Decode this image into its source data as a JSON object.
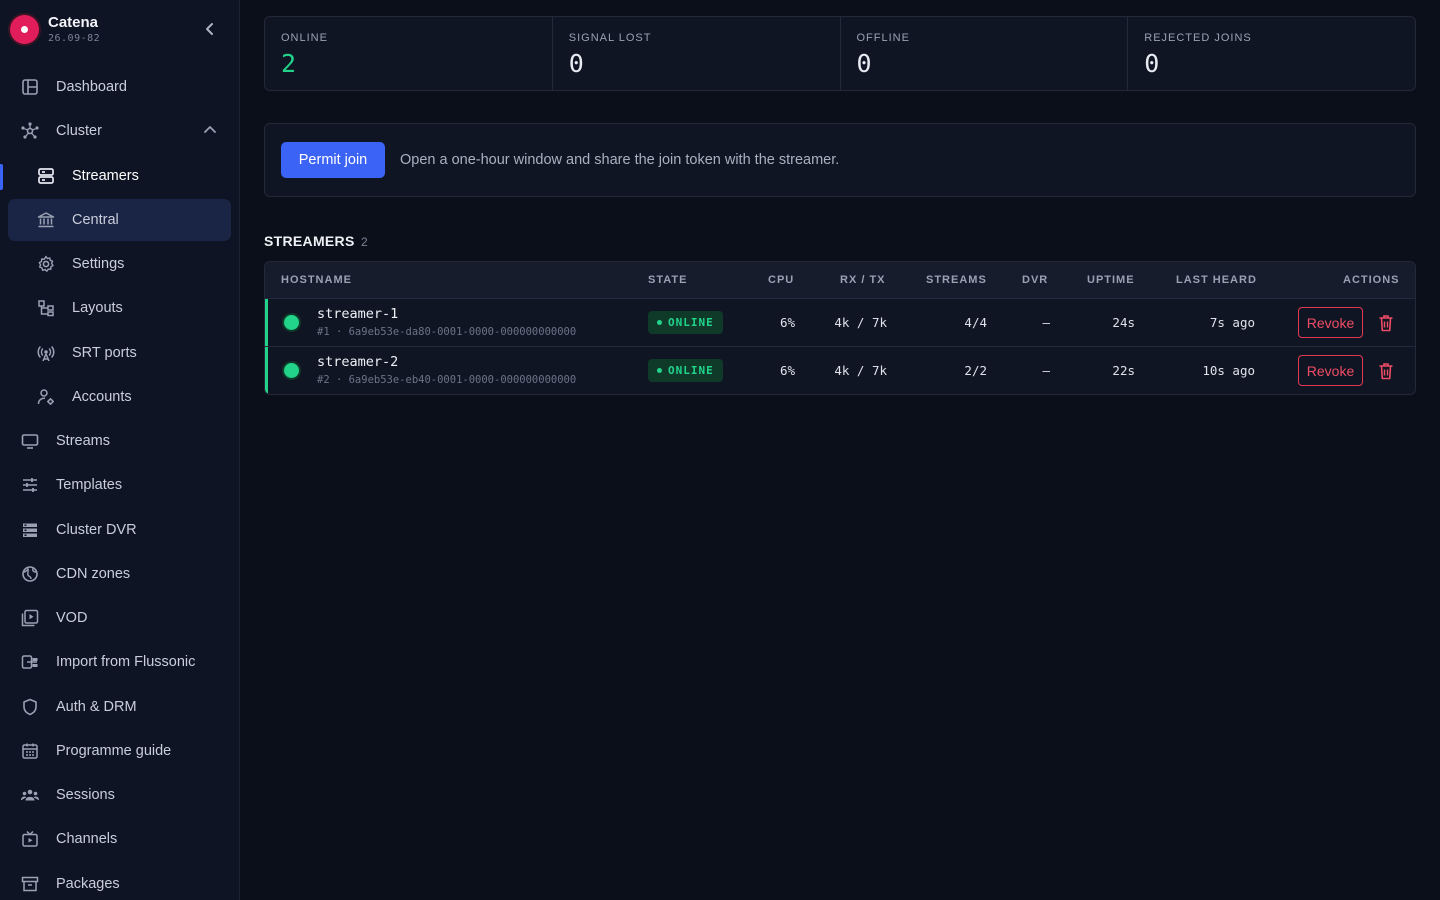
{
  "app": {
    "name": "Catena",
    "version": "26.09-82"
  },
  "sidebar": {
    "items": [
      {
        "label": "Dashboard"
      },
      {
        "label": "Cluster"
      },
      {
        "label": "Streamers"
      },
      {
        "label": "Central"
      },
      {
        "label": "Settings"
      },
      {
        "label": "Layouts"
      },
      {
        "label": "SRT ports"
      },
      {
        "label": "Accounts"
      },
      {
        "label": "Streams"
      },
      {
        "label": "Templates"
      },
      {
        "label": "Cluster DVR"
      },
      {
        "label": "CDN zones"
      },
      {
        "label": "VOD"
      },
      {
        "label": "Import from Flussonic"
      },
      {
        "label": "Auth & DRM"
      },
      {
        "label": "Programme guide"
      },
      {
        "label": "Sessions"
      },
      {
        "label": "Channels"
      },
      {
        "label": "Packages"
      }
    ]
  },
  "stats": [
    {
      "label": "ONLINE",
      "value": "2"
    },
    {
      "label": "SIGNAL LOST",
      "value": "0"
    },
    {
      "label": "OFFLINE",
      "value": "0"
    },
    {
      "label": "REJECTED JOINS",
      "value": "0"
    }
  ],
  "permit": {
    "button_label": "Permit join",
    "description": "Open a one-hour window and share the join token with the streamer."
  },
  "streamers_section": {
    "title": "STREAMERS",
    "count": "2"
  },
  "table": {
    "headers": {
      "hostname": "HOSTNAME",
      "state": "STATE",
      "cpu": "CPU",
      "rxtx": "RX / TX",
      "streams": "STREAMS",
      "dvr": "DVR",
      "uptime": "UPTIME",
      "last_heard": "LAST HEARD",
      "actions": "ACTIONS"
    },
    "rows": [
      {
        "hostname": "streamer-1",
        "sub": "#1 · 6a9eb53e-da80-0001-0000-000000000000",
        "state": "ONLINE",
        "cpu": "6%",
        "rxtx": "4k / 7k",
        "streams": "4/4",
        "dvr": "—",
        "uptime": "24s",
        "last_heard": "7s ago",
        "revoke_label": "Revoke"
      },
      {
        "hostname": "streamer-2",
        "sub": "#2 · 6a9eb53e-eb40-0001-0000-000000000000",
        "state": "ONLINE",
        "cpu": "6%",
        "rxtx": "4k / 7k",
        "streams": "2/2",
        "dvr": "—",
        "uptime": "22s",
        "last_heard": "10s ago",
        "revoke_label": "Revoke"
      }
    ]
  },
  "colors": {
    "accent": "#3b63f5",
    "online": "#22d38a",
    "danger": "#ef4d65",
    "brand": "#e11d5b"
  }
}
